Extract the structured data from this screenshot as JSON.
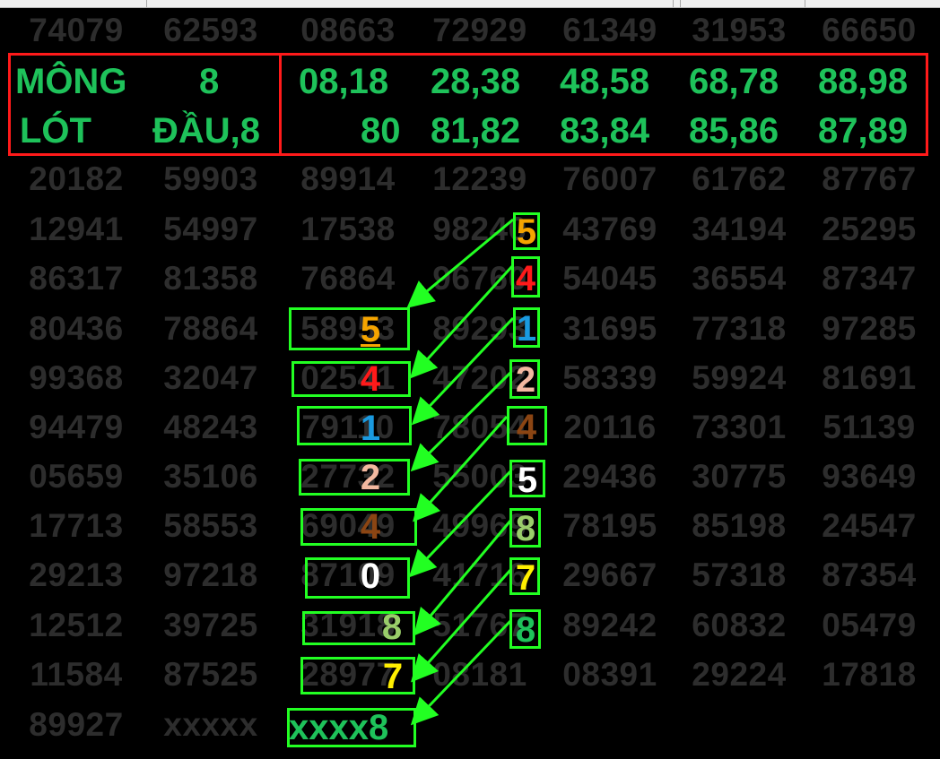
{
  "rows": [
    [
      "74079",
      "62593",
      "08663",
      "72929",
      "61349",
      "31953",
      "66650"
    ],
    [
      "20182",
      "59903",
      "89914",
      "12239",
      "76007",
      "61762",
      "87767"
    ],
    [
      "12941",
      "54997",
      "17538",
      "98240",
      "43769",
      "34194",
      "25295"
    ],
    [
      "86317",
      "81358",
      "76864",
      "96760",
      "54045",
      "36554",
      "87347"
    ],
    [
      "80436",
      "78864",
      "58953",
      "89293",
      "31695",
      "77318",
      "97285"
    ],
    [
      "99368",
      "32047",
      "02541",
      "47202",
      "58339",
      "59924",
      "81691"
    ],
    [
      "94479",
      "48243",
      "79110",
      "78054",
      "20116",
      "73301",
      "51139"
    ],
    [
      "05659",
      "35106",
      "27732",
      "55003",
      "29436",
      "30775",
      "93649"
    ],
    [
      "17713",
      "58553",
      "69049",
      "49969",
      "78195",
      "85198",
      "24547"
    ],
    [
      "29213",
      "97218",
      "87109",
      "41716",
      "29667",
      "57318",
      "87354"
    ],
    [
      "12512",
      "39725",
      "31918",
      "51767",
      "89242",
      "60832",
      "05479"
    ],
    [
      "11584",
      "87525",
      "28977",
      "08181",
      "08391",
      "29224",
      "17818"
    ],
    [
      "89927",
      "xxxxx"
    ]
  ],
  "highlight": {
    "row1": {
      "label": "MÔNG",
      "value": "8",
      "pairs": [
        "08,18",
        "28,38",
        "48,58",
        "68,78",
        "88,98"
      ]
    },
    "row2": {
      "label": "LÓT",
      "value": "ĐẦU,8",
      "pairs": [
        "80",
        "81,82",
        "83,84",
        "85,86",
        "87,89"
      ]
    }
  },
  "colors": {
    "gray_digits": "#2d2d2d",
    "highlight_text": "#1ec25a",
    "red_border": "#ff1a1a",
    "green_box": "#22ff22"
  },
  "chain_right": [
    {
      "digit": "5",
      "color": "#f5a500"
    },
    {
      "digit": "4",
      "color": "#ff1a1a"
    },
    {
      "digit": "1",
      "color": "#1a9ae0"
    },
    {
      "digit": "2",
      "color": "#f3b8a0"
    },
    {
      "digit": "4",
      "color": "#8b4513"
    },
    {
      "digit": "5",
      "color": "#ffffff"
    },
    {
      "digit": "8",
      "color": "#9acd6a"
    },
    {
      "digit": "7",
      "color": "#ffee00"
    },
    {
      "digit": "8",
      "color": "#1ec25a"
    }
  ],
  "chain_left": [
    {
      "digit": "5",
      "color": "#f5a500"
    },
    {
      "digit": "4",
      "color": "#ff1a1a"
    },
    {
      "digit": "1",
      "color": "#1a9ae0"
    },
    {
      "digit": "2",
      "color": "#f3b8a0"
    },
    {
      "digit": "4",
      "color": "#8b4513"
    },
    {
      "digit": "0",
      "color": "#ffffff"
    },
    {
      "digit": "8",
      "color": "#9acd6a"
    },
    {
      "digit": "7",
      "color": "#ffee00"
    }
  ],
  "result": {
    "prefix": "xxxx",
    "digit": "8",
    "color": "#1ec25a"
  }
}
